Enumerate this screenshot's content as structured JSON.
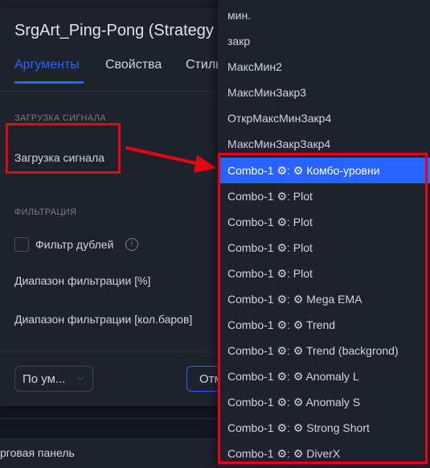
{
  "dialog": {
    "title": "SrgArt_Ping-Pong (Strategy",
    "tabs": [
      {
        "label": "Аргументы",
        "active": true
      },
      {
        "label": "Свойства",
        "active": false
      },
      {
        "label": "Стиль",
        "active": false
      }
    ],
    "section_signal": "ЗАГРУЗКА СИГНАЛА",
    "signal_label": "Загрузка сигнала",
    "section_filter": "ФИЛЬТРАЦИЯ",
    "filter_dup_label": "Фильтр дублей",
    "filter_dup_checked": false,
    "filter_range_pct": "Диапазон фильтрации [%]",
    "filter_range_bars": "Диапазон фильтрации [кол.баров]",
    "defaults_select": "По ум...",
    "cancel_partial": "Отм"
  },
  "bottom_bar": {
    "label": "рговая панель"
  },
  "dropdown": {
    "items": [
      {
        "label": "мин.",
        "selected": false
      },
      {
        "label": "закр",
        "selected": false
      },
      {
        "label": "МаксМин2",
        "selected": false
      },
      {
        "label": "МаксМинЗакр3",
        "selected": false
      },
      {
        "label": "ОткрМаксМинЗакр4",
        "selected": false
      },
      {
        "label": "МаксМинЗакрЗакр4",
        "selected": false
      },
      {
        "label": "Combo-1 ⚙: ⚙ Комбо-уровни",
        "selected": true
      },
      {
        "label": "Combo-1 ⚙: Plot",
        "selected": false
      },
      {
        "label": "Combo-1 ⚙: Plot",
        "selected": false
      },
      {
        "label": "Combo-1 ⚙: Plot",
        "selected": false
      },
      {
        "label": "Combo-1 ⚙: Plot",
        "selected": false
      },
      {
        "label": "Combo-1 ⚙: ⚙ Mega EMA",
        "selected": false
      },
      {
        "label": "Combo-1 ⚙: ⚙ Trend",
        "selected": false
      },
      {
        "label": "Combo-1 ⚙: ⚙ Trend (backgrond)",
        "selected": false
      },
      {
        "label": "Combo-1 ⚙: ⚙ Anomaly L",
        "selected": false
      },
      {
        "label": "Combo-1 ⚙: ⚙ Anomaly S",
        "selected": false
      },
      {
        "label": "Combo-1 ⚙: ⚙ Strong Short",
        "selected": false
      },
      {
        "label": "Combo-1 ⚙: ⚙ DiverX",
        "selected": false
      }
    ]
  },
  "colors": {
    "accent": "#2962ff",
    "highlight": "#e30613",
    "panel": "#1e222d",
    "background": "#131722"
  }
}
